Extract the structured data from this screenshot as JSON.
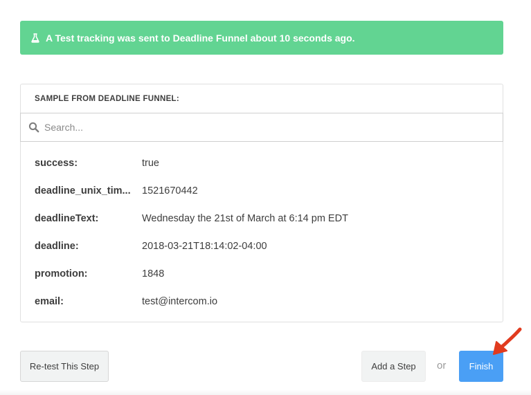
{
  "banner": {
    "icon": "flask-icon",
    "message": "A Test tracking was sent to Deadline Funnel about 10 seconds ago.",
    "color": "#62d492"
  },
  "sample": {
    "header": "SAMPLE FROM DEADLINE FUNNEL:",
    "search": {
      "placeholder": "Search...",
      "value": "",
      "icon": "search-icon"
    },
    "fields": [
      {
        "key": "success:",
        "value": "true"
      },
      {
        "key": "deadline_unix_tim...",
        "value": "1521670442"
      },
      {
        "key": "deadlineText:",
        "value": "Wednesday the 21st of March at 6:14 pm EDT"
      },
      {
        "key": "deadline:",
        "value": "2018-03-21T18:14:02-04:00"
      },
      {
        "key": "promotion:",
        "value": "1848"
      },
      {
        "key": "email:",
        "value": "test@intercom.io"
      }
    ]
  },
  "footer": {
    "retest_label": "Re-test This Step",
    "add_step_label": "Add a Step",
    "or_label": "or",
    "finish_label": "Finish",
    "finish_color": "#4a9ff5",
    "annotation": "arrow-pointer-icon"
  }
}
